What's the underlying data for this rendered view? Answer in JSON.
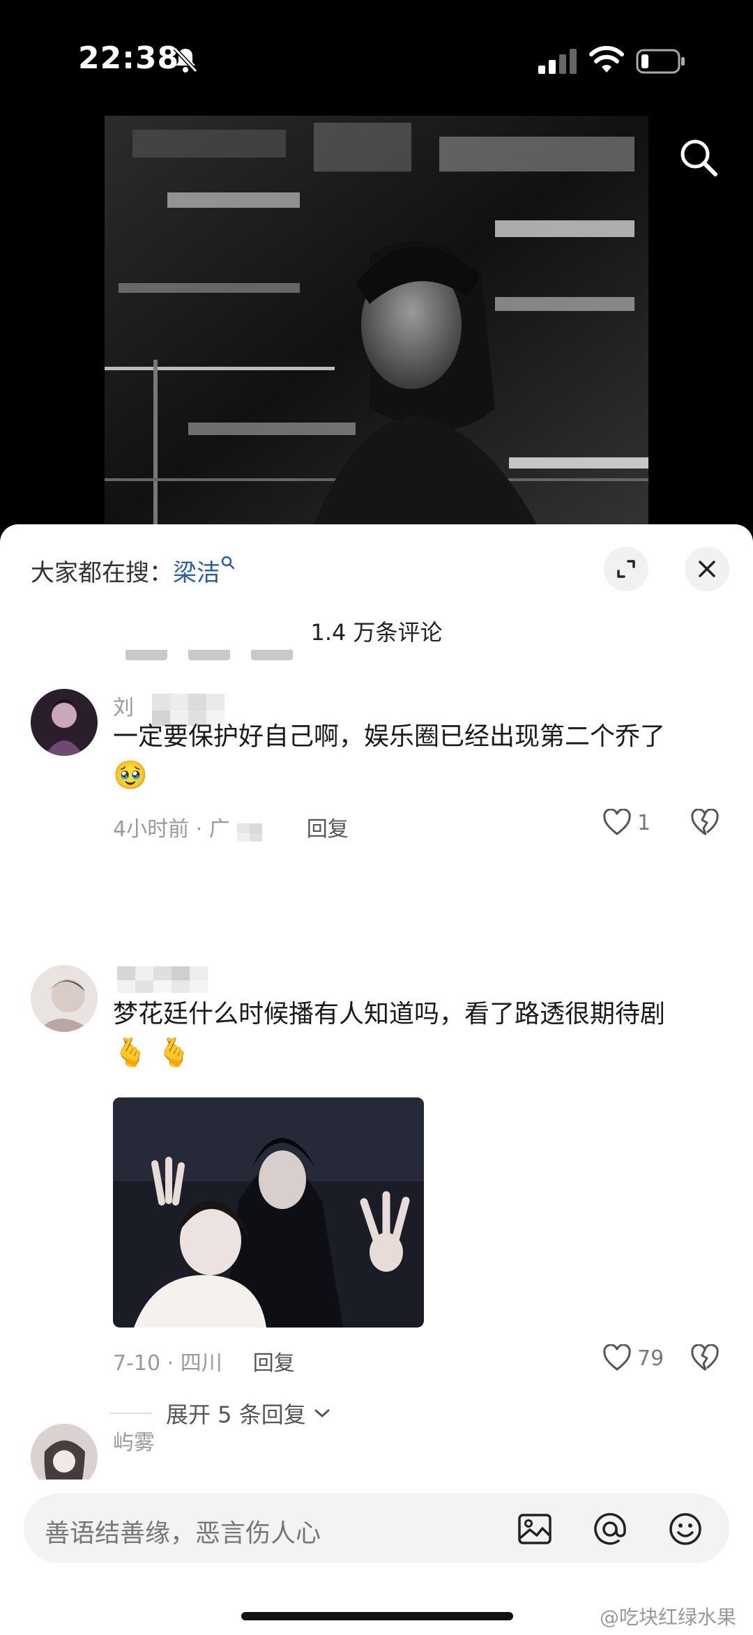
{
  "status_bar": {
    "time": "22:38",
    "icons": [
      "bell-off-icon",
      "cellular-signal-icon",
      "wifi-icon",
      "battery-low-icon"
    ]
  },
  "video": {
    "search_icon": "search-icon"
  },
  "sheet": {
    "trending_prefix": "大家都在搜：",
    "trending_keyword": "梁洁",
    "comment_count": "1.4 万条评论",
    "expand_icon": "expand-icon",
    "close_icon": "close-icon"
  },
  "comments": [
    {
      "username": "刘",
      "text": "一定要保护好自己啊，娱乐圈已经出现第二个乔了",
      "emoji": "🥹",
      "time": "4小时前 · 广",
      "reply_label": "回复",
      "likes": "1"
    },
    {
      "username": "",
      "text": "梦花廷什么时候播有人知道吗，看了路透很期待剧",
      "emoji": "🫰 🫰",
      "time": "7-10 · 四川",
      "reply_label": "回复",
      "likes": "79",
      "expand_replies": "展开 5 条回复"
    },
    {
      "username": "屿雾"
    }
  ],
  "input_bar": {
    "placeholder": "善语结善缘，恶言伤人心",
    "icons": [
      "image-icon",
      "at-icon",
      "emoji-icon"
    ]
  },
  "watermark": "@吃块红绿水果",
  "colors": {
    "keyword_blue": "#2a5d9e",
    "sheet_bg": "#ffffff",
    "secondary_text": "#9a9a9a"
  }
}
